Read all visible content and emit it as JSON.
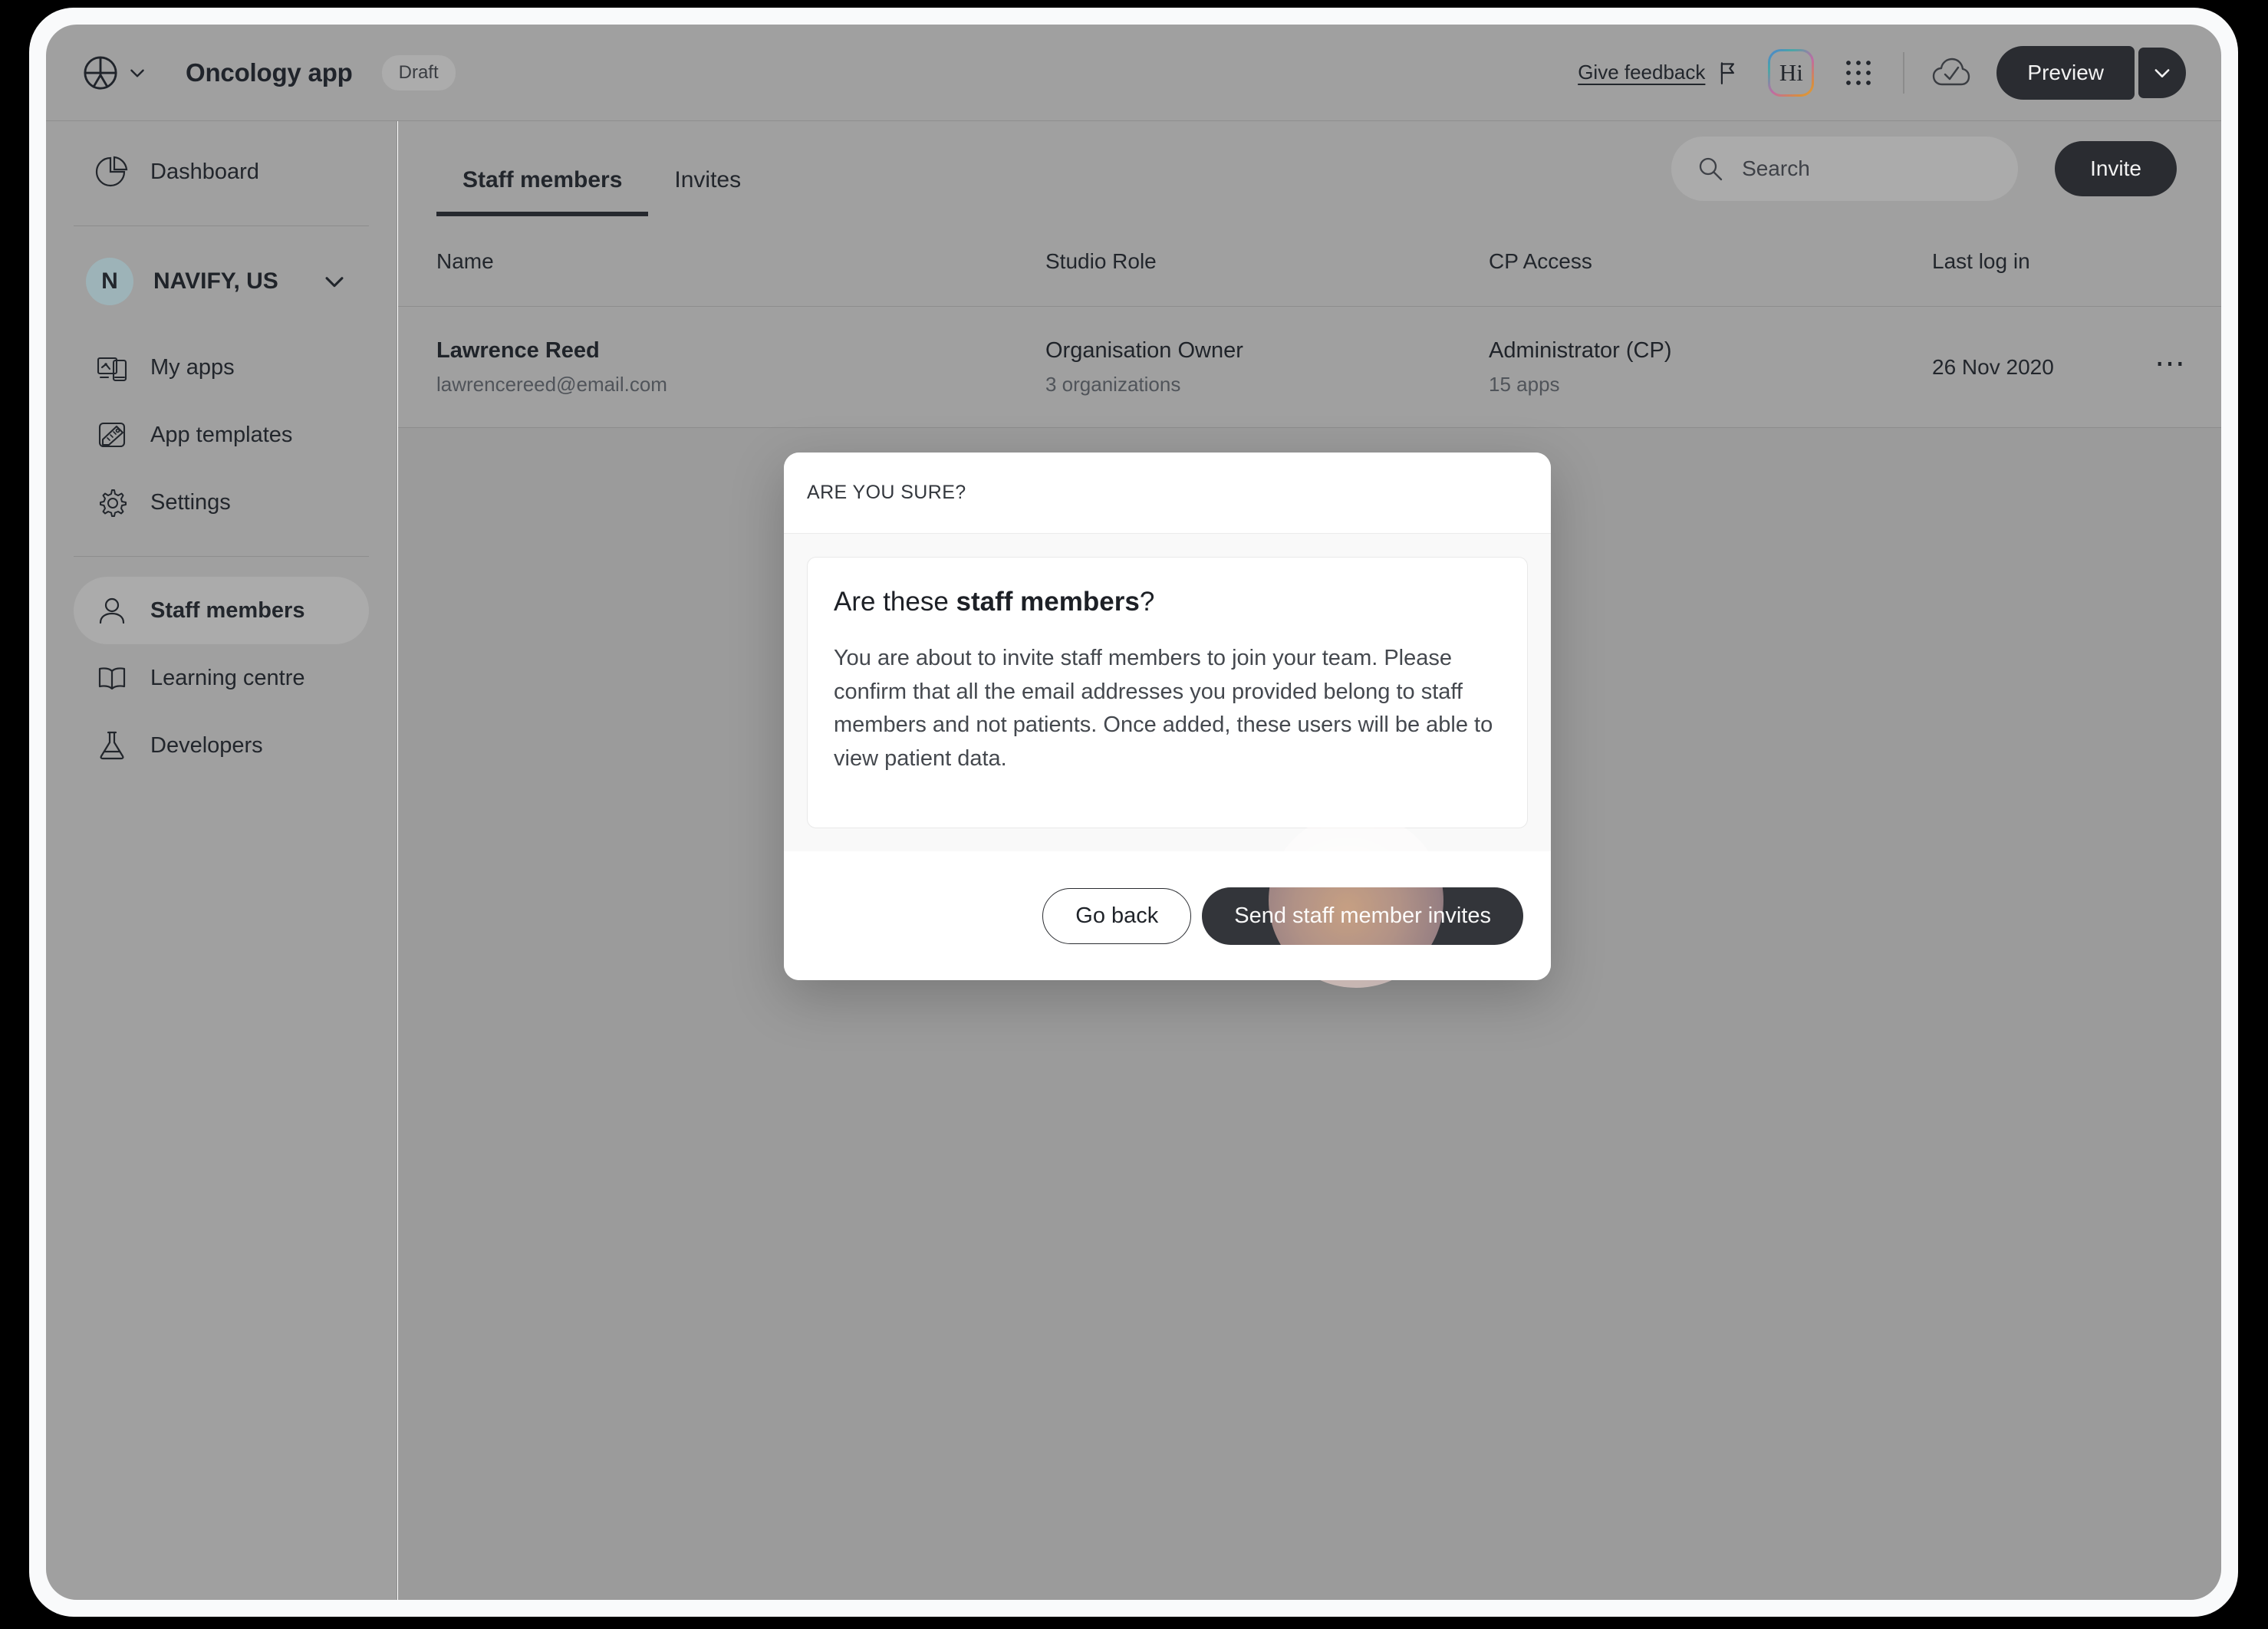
{
  "topbar": {
    "logo_icon": "accessibility-circle-icon",
    "logo_chevron_icon": "chevron-down-icon",
    "app_title": "Oncology app",
    "status_badge": "Draft",
    "give_feedback": "Give feedback",
    "flag_icon": "flag-icon",
    "hi_badge": "Hi",
    "grid_icon": "apps-grid-icon",
    "cloud_icon": "cloud-check-icon",
    "preview_label": "Preview",
    "preview_dropdown_icon": "chevron-down-icon"
  },
  "sidebar": {
    "dashboard": {
      "label": "Dashboard",
      "icon": "pie-chart-icon"
    },
    "org": {
      "avatar_letter": "N",
      "name": "NAVIFY, US",
      "chevron_icon": "chevron-down-icon"
    },
    "items": [
      {
        "label": "My apps",
        "icon": "devices-icon",
        "active": false
      },
      {
        "label": "App templates",
        "icon": "template-ruler-icon",
        "active": false
      },
      {
        "label": "Settings",
        "icon": "gear-icon",
        "active": false
      },
      {
        "label": "Staff members",
        "icon": "user-icon",
        "active": true
      },
      {
        "label": "Learning centre",
        "icon": "book-icon",
        "active": false
      },
      {
        "label": "Developers",
        "icon": "flask-icon",
        "active": false
      }
    ]
  },
  "content": {
    "tabs": [
      {
        "label": "Staff members",
        "active": true
      },
      {
        "label": "Invites",
        "active": false
      }
    ],
    "search": {
      "placeholder": "Search",
      "value": "",
      "icon": "search-icon"
    },
    "invite_button": "Invite",
    "table": {
      "columns": [
        "Name",
        "Studio Role",
        "CP Access",
        "Last log in"
      ],
      "rows": [
        {
          "name": "Lawrence Reed",
          "email": "lawrencereed@email.com",
          "studio_role": "Organisation Owner",
          "organizations": "3 organizations",
          "cp_access": "Administrator (CP)",
          "apps": "15 apps",
          "last_login": "26 Nov 2020",
          "menu_icon": "ellipsis-icon"
        }
      ]
    }
  },
  "modal": {
    "eyebrow": "ARE YOU SURE?",
    "title_prefix": "Are these ",
    "title_bold": "staff members",
    "title_suffix": "?",
    "body": "You are about to invite staff members to join your team. Please confirm that all the email addresses you provided belong to staff members and not patients. Once added, these users will be able to view patient data.",
    "go_back_label": "Go back",
    "send_label": "Send staff member invites"
  },
  "colors": {
    "accent_dark": "#2a2c31",
    "overlay": "#9b9b9b",
    "surface": "#a0a0a0",
    "org_avatar": "#9db3b8",
    "click_glow": "#ffba82"
  }
}
